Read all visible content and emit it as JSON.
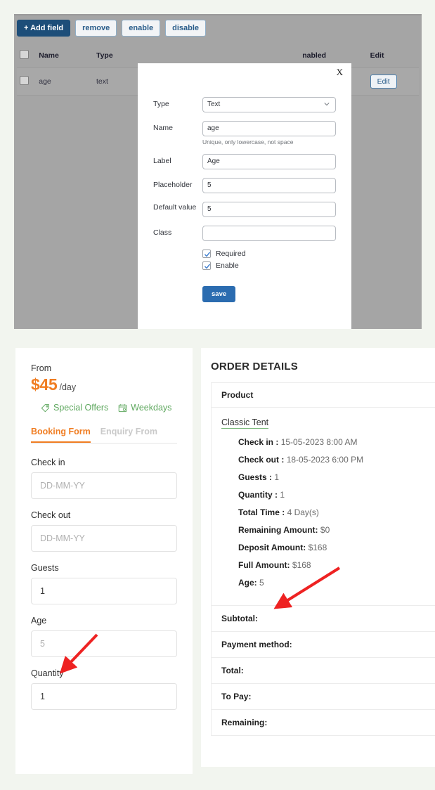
{
  "admin": {
    "toolbar": {
      "add_field": "+ Add field",
      "remove": "remove",
      "enable": "enable",
      "disable": "disable"
    },
    "table": {
      "headers": [
        "",
        "Name",
        "Type",
        "",
        "nabled",
        "Edit"
      ],
      "rows": [
        {
          "name": "age",
          "type": "text",
          "mid": "",
          "enabled": "",
          "edit": "Edit"
        }
      ]
    }
  },
  "modal": {
    "close": "X",
    "type_label": "Type",
    "type_value": "Text",
    "name_label": "Name",
    "name_value": "age",
    "name_hint": "Unique, only lowercase, not space",
    "label_label": "Label",
    "label_value": "Age",
    "placeholder_label": "Placeholder",
    "placeholder_value": "5",
    "default_label": "Default value",
    "default_value": "5",
    "class_label": "Class",
    "class_value": "",
    "required_label": "Required",
    "enable_label": "Enable",
    "save_label": "save"
  },
  "booking": {
    "from_label": "From",
    "price": "$45",
    "price_unit": "/day",
    "badge_offers": "Special Offers",
    "badge_weekdays": "Weekdays",
    "tab_booking": "Booking Form",
    "tab_enquiry": "Enquiry From",
    "fields": [
      {
        "label": "Check in",
        "value": "DD-MM-YY",
        "is_placeholder": true
      },
      {
        "label": "Check out",
        "value": "DD-MM-YY",
        "is_placeholder": true
      },
      {
        "label": "Guests",
        "value": "1",
        "is_placeholder": false
      },
      {
        "label": "Age",
        "value": "5",
        "is_placeholder": true
      },
      {
        "label": "Quantity",
        "value": "1",
        "is_placeholder": false
      }
    ]
  },
  "order": {
    "title": "ORDER DETAILS",
    "product_header": "Product",
    "product_name": "Classic Tent",
    "attributes": [
      {
        "key": "Check in :",
        "value": "15-05-2023 8:00 AM"
      },
      {
        "key": "Check out :",
        "value": "18-05-2023 6:00 PM"
      },
      {
        "key": "Guests :",
        "value": "1"
      },
      {
        "key": "Quantity :",
        "value": "1"
      },
      {
        "key": "Total Time :",
        "value": "4 Day(s)"
      },
      {
        "key": "Remaining Amount:",
        "value": "$0"
      },
      {
        "key": "Deposit Amount:",
        "value": "$168"
      },
      {
        "key": "Full Amount:",
        "value": "$168"
      },
      {
        "key": "Age:",
        "value": "5"
      }
    ],
    "summary_rows": [
      "Subtotal:",
      "Payment method:",
      "Total:",
      "To Pay:",
      "Remaining:"
    ]
  },
  "colors": {
    "page_bg": "#f2f5ef",
    "overlay": "#a5a5a5",
    "accent_orange": "#f07d22",
    "accent_green": "#5fa85f",
    "primary_blue": "#1d4e79",
    "arrow_red": "#ee2222"
  }
}
